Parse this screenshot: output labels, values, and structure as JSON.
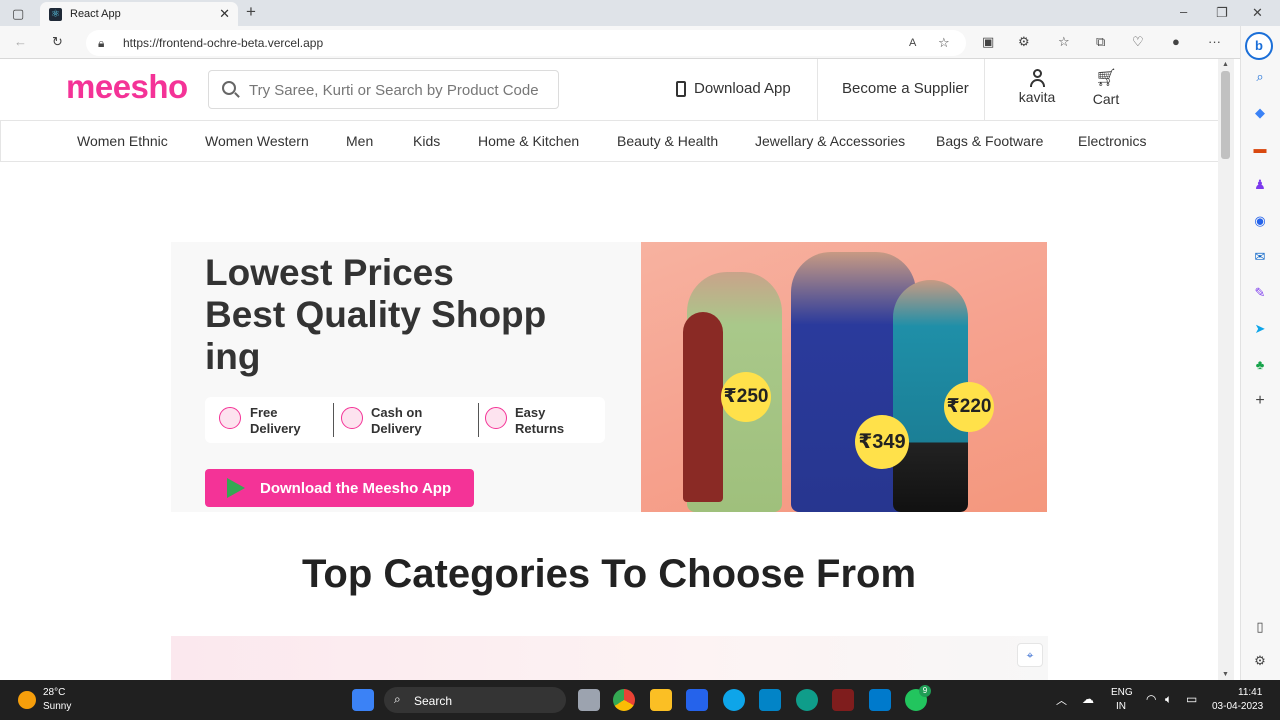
{
  "browser": {
    "tab_title": "React App",
    "url": "https://frontend-ochre-beta.vercel.app"
  },
  "header": {
    "logo": "meesho",
    "search_placeholder": "Try Saree, Kurti or Search by Product Code",
    "download_app": "Download App",
    "become_supplier": "Become a Supplier",
    "profile_label": "kavita",
    "cart_label": "Cart"
  },
  "nav": {
    "items": [
      "Women Ethnic",
      "Women Western",
      "Men",
      "Kids",
      "Home & Kitchen",
      "Beauty & Health",
      "Jewellary & Accessories",
      "Bags & Footware",
      "Electronics"
    ]
  },
  "hero": {
    "headline_line1": "Lowest Prices",
    "headline_line2": "Best Quality Shopp",
    "headline_line3": "ing",
    "features": [
      {
        "line1": "Free",
        "line2": "Delivery"
      },
      {
        "line1": "Cash on",
        "line2": "Delivery"
      },
      {
        "line1": "Easy",
        "line2": "Returns"
      }
    ],
    "app_button": "Download the Meesho App",
    "prices": [
      "₹250",
      "₹349",
      "₹220"
    ]
  },
  "categories_heading": "Top Categories To Choose From",
  "taskbar": {
    "temperature": "28°C",
    "weather": "Sunny",
    "search": "Search",
    "lang1": "ENG",
    "lang2": "IN",
    "time": "11:41",
    "date": "03-04-2023",
    "whatsapp_badge": "9"
  }
}
